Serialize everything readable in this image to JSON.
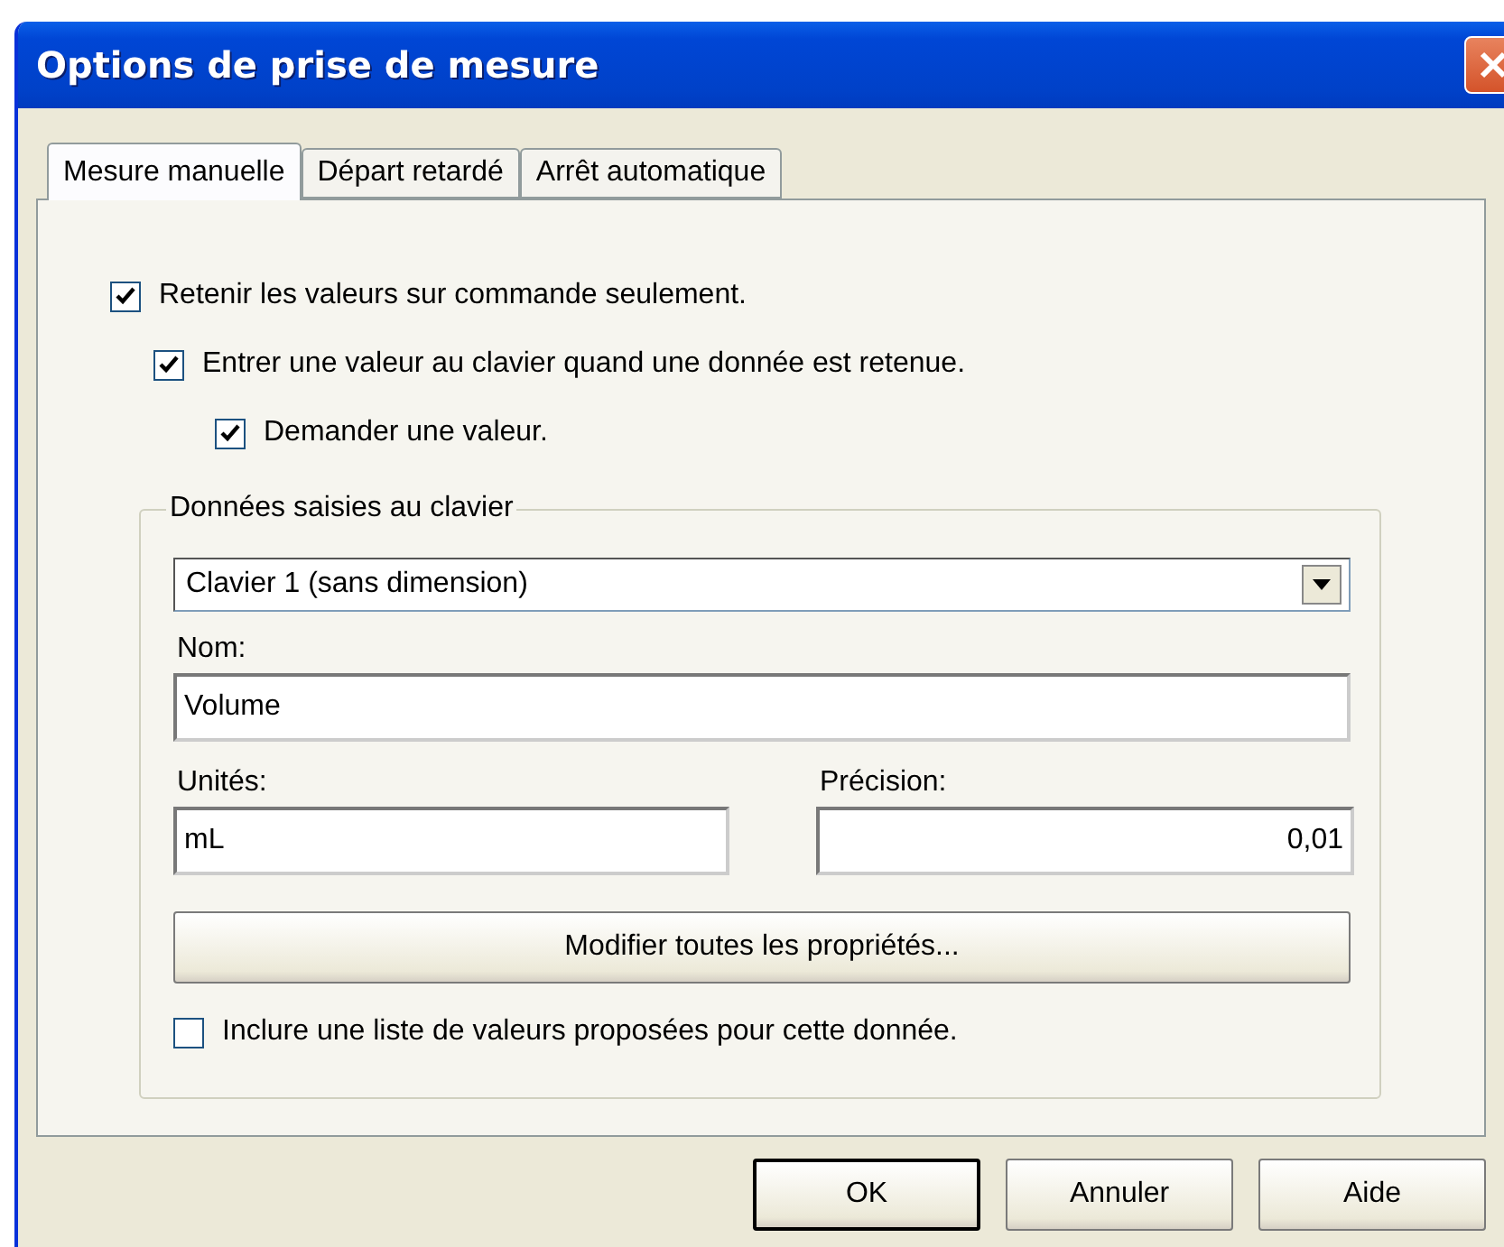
{
  "window": {
    "title": "Options de prise de mesure"
  },
  "tabs": [
    {
      "label": "Mesure manuelle",
      "selected": true
    },
    {
      "label": "Départ retardé",
      "selected": false
    },
    {
      "label": "Arrêt automatique",
      "selected": false
    }
  ],
  "options": [
    {
      "label": "Retenir les valeurs sur commande seulement.",
      "checked": true,
      "children": [
        {
          "label": "Entrer une valeur au clavier quand une donnée est retenue.",
          "checked": true,
          "children": [
            {
              "label": "Demander une valeur.",
              "checked": true
            }
          ]
        }
      ]
    }
  ],
  "group": {
    "title": "Données saisies au clavier",
    "dropdown": {
      "value": "Clavier 1 (sans dimension)"
    },
    "name_label": "Nom:",
    "name_value": "Volume",
    "units_label": "Unités:",
    "units_value": "mL",
    "precision_label": "Précision:",
    "precision_value": "0,01",
    "edit_button": "Modifier toutes les propriétés...",
    "include_list": {
      "label": "Inclure une liste de valeurs proposées pour cette donnée.",
      "checked": false
    }
  },
  "buttons": [
    {
      "label": "OK",
      "default": true
    },
    {
      "label": "Annuler",
      "default": false
    },
    {
      "label": "Aide",
      "default": false
    }
  ]
}
